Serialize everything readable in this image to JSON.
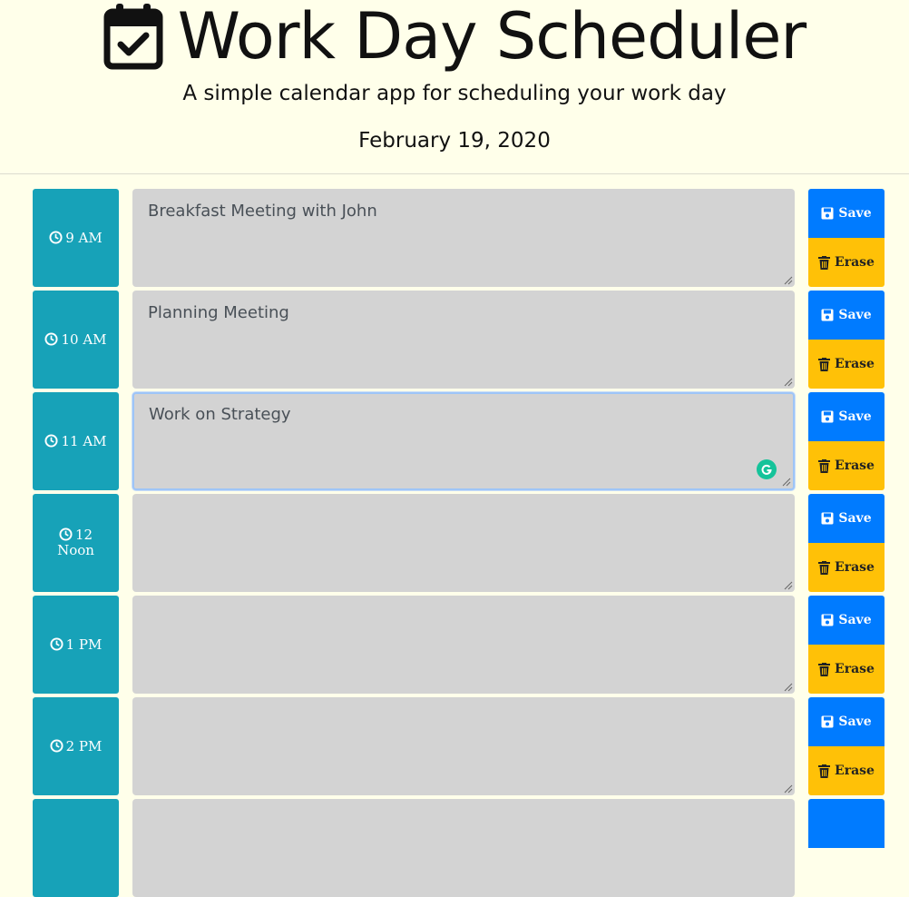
{
  "header": {
    "title": "Work Day Scheduler",
    "subtitle": "A simple calendar app for scheduling your work day",
    "date": "February 19, 2020",
    "icon": "calendar-check-icon"
  },
  "colors": {
    "background": "#ffffea",
    "hour_block": "#17a2b8",
    "textarea": "#d3d3d3",
    "save": "#007bff",
    "erase": "#ffc107"
  },
  "buttons": {
    "save_label": "Save",
    "erase_label": "Erase"
  },
  "rows": [
    {
      "hour": "9 AM",
      "hour_line2": "",
      "text": "Breakfast Meeting with John"
    },
    {
      "hour": "10 AM",
      "hour_line2": "",
      "text": "Planning Meeting"
    },
    {
      "hour": "11 AM",
      "hour_line2": "",
      "text": "Work on Strategy"
    },
    {
      "hour": "12",
      "hour_line2": "Noon",
      "text": ""
    },
    {
      "hour": "1 PM",
      "hour_line2": "",
      "text": ""
    },
    {
      "hour": "2 PM",
      "hour_line2": "",
      "text": ""
    },
    {
      "hour": "",
      "hour_line2": "",
      "text": ""
    }
  ]
}
